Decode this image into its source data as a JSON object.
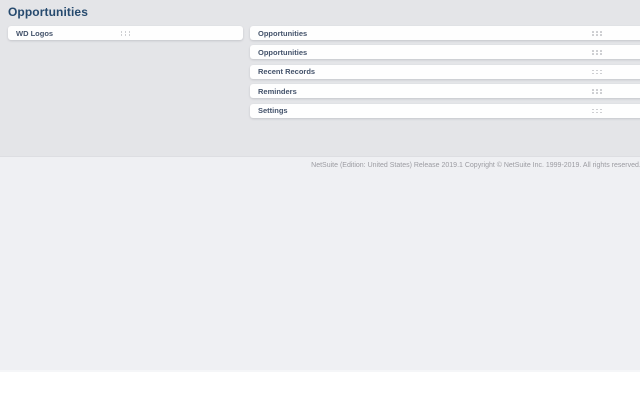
{
  "page_title": "Opportunities",
  "portlets": {
    "left": [
      {
        "title": "WD Logos",
        "drag_handle_icon": "six-dot-grip"
      }
    ],
    "right": [
      {
        "title": "Opportunities",
        "drag_handle_icon": "six-dot-grip"
      },
      {
        "title": "Opportunities",
        "drag_handle_icon": "six-dot-grip"
      },
      {
        "title": "Recent Records",
        "drag_handle_icon": "six-dot-grip"
      },
      {
        "title": "Reminders",
        "drag_handle_icon": "six-dot-grip"
      },
      {
        "title": "Settings",
        "drag_handle_icon": "six-dot-grip"
      }
    ]
  },
  "footer": {
    "copyright": "NetSuite (Edition: United States) Release 2019.1 Copyright © NetSuite Inc. 1999-2019. All rights reserved."
  },
  "colors": {
    "page_title_text": "#264a6e",
    "portlet_title_text": "#44536b",
    "portlet_bg": "#fefefe",
    "dashboard_bg": "#e4e5e8",
    "footer_bg": "#eff0f3",
    "footer_text": "#9b9ba1",
    "drag_handle_dots": "#c7c8cc"
  }
}
